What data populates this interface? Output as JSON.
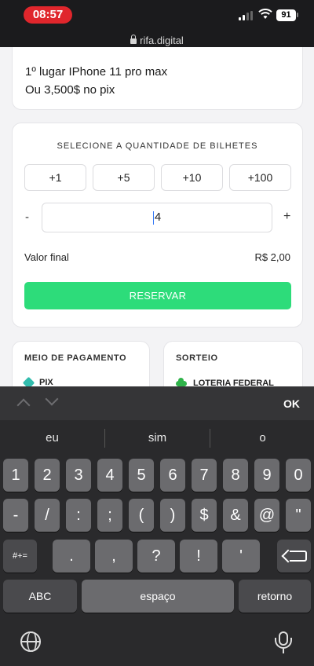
{
  "status_bar": {
    "time": "08:57",
    "battery": "91",
    "url": "rifa.digital"
  },
  "prize": {
    "line1": "1º lugar IPhone 11 pro max",
    "line2": "Ou 3,500$ no pix"
  },
  "quantity": {
    "title": "SELECIONE A QUANTIDADE DE BILHETES",
    "increments": [
      "+1",
      "+5",
      "+10",
      "+100"
    ],
    "minus": "-",
    "plus": "+",
    "value": "4",
    "total_label": "Valor final",
    "total_value": "R$ 2,00",
    "reserve_label": "RESERVAR"
  },
  "payment": {
    "title": "MEIO DE PAGAMENTO",
    "method": "PIX"
  },
  "draw": {
    "title": "SORTEIO",
    "method": "LOTERIA FEDERAL"
  },
  "keyboard": {
    "done": "OK",
    "suggestions": [
      "eu",
      "sim",
      "o"
    ],
    "row1": [
      "1",
      "2",
      "3",
      "4",
      "5",
      "6",
      "7",
      "8",
      "9",
      "0"
    ],
    "row2": [
      "-",
      "/",
      ":",
      ";",
      "(",
      ")",
      "$",
      "&",
      "@",
      "\""
    ],
    "row3_left": "#+=",
    "row3": [
      ".",
      ",",
      "?",
      "!",
      "'"
    ],
    "abc": "ABC",
    "space": "espaço",
    "return": "retorno"
  },
  "colors": {
    "accent_green": "#2ddc7a",
    "time_pill": "#e0262c"
  }
}
